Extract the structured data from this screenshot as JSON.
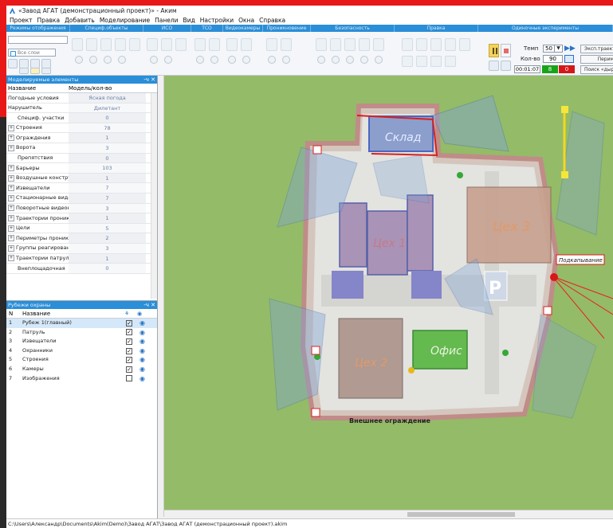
{
  "window": {
    "title": "«Завод АГАТ (демонстрационный проект)» - Аким"
  },
  "menu": [
    "Проект",
    "Правка",
    "Добавить",
    "Моделирование",
    "Панели",
    "Вид",
    "Настройки",
    "Окна",
    "Справка"
  ],
  "ribbon": {
    "groups": [
      "Режимы отображения",
      "Специф.объекты",
      "ИСО",
      "ТСО",
      "Видеокамеры",
      "Проникновение",
      "Безопасность",
      "Правка",
      "Одиночные эксперименты"
    ],
    "layer_search_placeholder": "Все слои",
    "tempo_label": "Темп",
    "tempo_value": "50",
    "count_label": "Кол-во",
    "count_value": "90",
    "timer": "00:01:07",
    "green_count": "8",
    "red_count": "0",
    "side_buttons": [
      "Эксп.траект",
      "Перим",
      "Поиск «дыр»"
    ]
  },
  "model_panel": {
    "title": "Моделируемые элементы",
    "col_name": "Название",
    "col_model": "Модель/кол-во",
    "rows": [
      {
        "name": "Погодные условия",
        "value": "Ясная погода",
        "expand": false,
        "indent": false
      },
      {
        "name": "Нарушитель",
        "value": "Дилетант",
        "expand": false,
        "indent": false
      },
      {
        "name": "Специф. участки",
        "value": "0",
        "expand": false,
        "indent": true
      },
      {
        "name": "Строения",
        "value": "78",
        "expand": true,
        "indent": false
      },
      {
        "name": "Ограждения",
        "value": "1",
        "expand": true,
        "indent": false
      },
      {
        "name": "Ворота",
        "value": "3",
        "expand": true,
        "indent": false
      },
      {
        "name": "Препятствия",
        "value": "0",
        "expand": false,
        "indent": true
      },
      {
        "name": "Барьеры",
        "value": "103",
        "expand": true,
        "indent": false
      },
      {
        "name": "Воздушные констру",
        "value": "1",
        "expand": true,
        "indent": false
      },
      {
        "name": "Извещатели",
        "value": "7",
        "expand": true,
        "indent": false
      },
      {
        "name": "Стационарные вида",
        "value": "7",
        "expand": true,
        "indent": false
      },
      {
        "name": "Поворотные видеок",
        "value": "3",
        "expand": true,
        "indent": false
      },
      {
        "name": "Траектории проник",
        "value": "1",
        "expand": true,
        "indent": false
      },
      {
        "name": "Цели",
        "value": "5",
        "expand": true,
        "indent": false
      },
      {
        "name": "Периметры проник",
        "value": "2",
        "expand": true,
        "indent": false
      },
      {
        "name": "Группы реагирован",
        "value": "3",
        "expand": true,
        "indent": false
      },
      {
        "name": "Траектории патрул",
        "value": "1",
        "expand": true,
        "indent": false
      },
      {
        "name": "Внеплощадочная",
        "value": "0",
        "expand": false,
        "indent": true
      }
    ]
  },
  "layers_panel": {
    "title": "Рубежи охраны",
    "col_n": "N",
    "col_name": "Название",
    "rows": [
      {
        "n": "1",
        "name": "Рубеж 1(главный)",
        "checked": true,
        "selected": true
      },
      {
        "n": "2",
        "name": "Патруль",
        "checked": true,
        "selected": false
      },
      {
        "n": "3",
        "name": "Извещатели",
        "checked": true,
        "selected": false
      },
      {
        "n": "4",
        "name": "Охранники",
        "checked": true,
        "selected": false
      },
      {
        "n": "5",
        "name": "Строения",
        "checked": true,
        "selected": false
      },
      {
        "n": "6",
        "name": "Камеры",
        "checked": true,
        "selected": false
      },
      {
        "n": "7",
        "name": "Изображения",
        "checked": false,
        "selected": false
      }
    ]
  },
  "map": {
    "labels": {
      "warehouse": "Склад",
      "shop1": "Цех 1",
      "shop2": "Цех 2",
      "shop3": "Цех 3",
      "office": "Офис",
      "fence": "Внешнее ограждение",
      "event": "Подкапывание"
    }
  },
  "status": {
    "path": "C:\\Users\\Александр\\Documents\\Akim(Demo)\\Завод АГАТ\\Завод АГАТ (демонстрационный проект).akim"
  },
  "colors": {
    "accent": "#2a8ed8",
    "grass": "#8fb865",
    "alarm": "#e81818"
  }
}
